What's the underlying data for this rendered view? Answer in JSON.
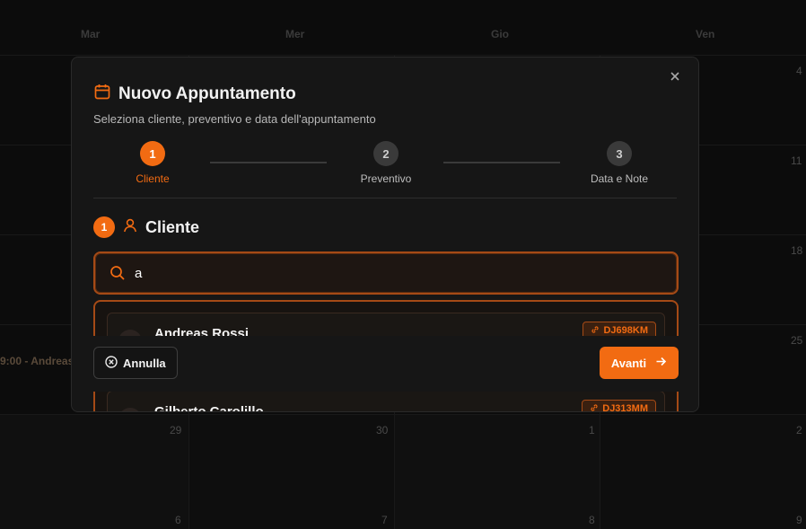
{
  "calendar": {
    "days": [
      "Mar",
      "Mer",
      "Gio",
      "Ven"
    ],
    "right_col_numbers": [
      "4",
      "11",
      "18",
      "25"
    ],
    "bottom_row1": [
      "29",
      "30",
      "1",
      "2"
    ],
    "bottom_row2": [
      "6",
      "7",
      "8",
      "9"
    ],
    "event_text": "9:00 - Andreas"
  },
  "modal": {
    "title": "Nuovo Appuntamento",
    "subtitle": "Seleziona cliente, preventivo e data dell'appuntamento",
    "close_icon": "close-icon",
    "steps": [
      {
        "number": "1",
        "label": "Cliente",
        "active": true
      },
      {
        "number": "2",
        "label": "Preventivo",
        "active": false
      },
      {
        "number": "3",
        "label": "Data e Note",
        "active": false
      }
    ],
    "section": {
      "number": "1",
      "title": "Cliente",
      "icon": "user-icon"
    },
    "search": {
      "value": "a",
      "placeholder": ""
    },
    "results": [
      {
        "name": "Andreas Rossi",
        "plate": "DJ698KM"
      },
      {
        "name": "Gilberto Carolillo",
        "plate": "DJ313MM"
      }
    ],
    "footer": {
      "cancel_label": "Annulla",
      "next_label": "Avanti"
    }
  },
  "colors": {
    "accent": "#f26b12",
    "background": "#0c0c0c",
    "modal": "#161616"
  }
}
